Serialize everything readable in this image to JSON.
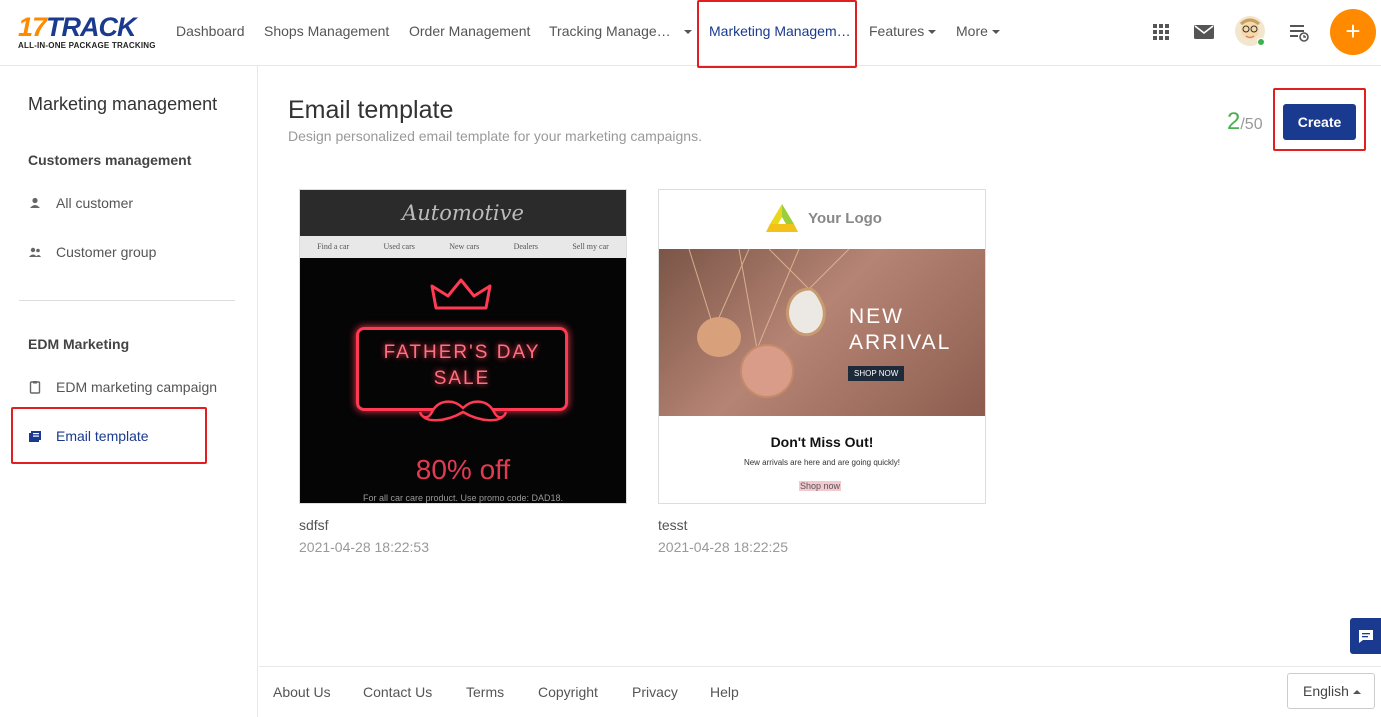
{
  "brand": {
    "name_prefix": "17",
    "name_suffix": "TRACK",
    "tagline": "ALL-IN-ONE PACKAGE TRACKING"
  },
  "nav": {
    "items": [
      {
        "label": "Dashboard"
      },
      {
        "label": "Shops Management"
      },
      {
        "label": "Order Management"
      },
      {
        "label": "Tracking Manage…"
      },
      {
        "label": "Marketing Managem…"
      },
      {
        "label": "Features"
      },
      {
        "label": "More"
      }
    ],
    "active": "Marketing Managem…"
  },
  "top_icons": [
    "apps-grid-icon",
    "mail-icon",
    "avatar",
    "task-list-icon",
    "add-icon"
  ],
  "fab_label": "+",
  "sidebar": {
    "title": "Marketing management",
    "sections": [
      {
        "heading": "Customers management",
        "items": [
          {
            "label": "All customer",
            "icon": "person-icon"
          },
          {
            "label": "Customer group",
            "icon": "group-icon"
          }
        ]
      },
      {
        "heading": "EDM Marketing",
        "items": [
          {
            "label": "EDM marketing campaign",
            "icon": "clipboard-icon"
          },
          {
            "label": "Email template",
            "icon": "template-icon"
          }
        ]
      }
    ],
    "active": "Email template"
  },
  "page": {
    "title": "Email template",
    "subtitle": "Design personalized email template for your marketing campaigns.",
    "quota_used": "2",
    "quota_total": "/50",
    "create_label": "Create"
  },
  "templates": [
    {
      "name": "sdfsf",
      "date": "2021-04-28 18:22:53",
      "preview": {
        "header": "Automotive",
        "nav": [
          "Find a car",
          "Used cars",
          "New cars",
          "Dealers",
          "Sell my car"
        ],
        "line1": "FATHER'S DAY",
        "line2": "SALE",
        "offer": "80% off",
        "footnote": "For all car care product. Use promo code: DAD18."
      }
    },
    {
      "name": "tesst",
      "date": "2021-04-28 18:22:25",
      "preview": {
        "logo": "Your Logo",
        "headline1": "NEW",
        "headline2": "ARRIVAL",
        "tag": "SHOP NOW",
        "title": "Don't Miss Out!",
        "note": "New arrivals are here and are going quickly!",
        "link": "Shop now"
      }
    }
  ],
  "footer": {
    "links": [
      "About Us",
      "Contact Us",
      "Terms",
      "Copyright",
      "Privacy",
      "Help"
    ],
    "language": "English"
  },
  "colors": {
    "brand_blue": "#1a3a8f",
    "brand_orange": "#ff8a00",
    "highlight_red": "#e02020",
    "quota_green": "#4caf50"
  }
}
